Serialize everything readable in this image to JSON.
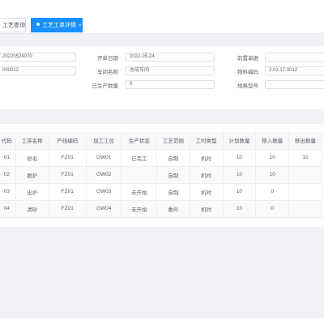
{
  "tabs": [
    {
      "label": "工艺查询",
      "active": false
    },
    {
      "label": "工艺工单详情",
      "active": true
    }
  ],
  "tab_close_glyph": "×",
  "accent_color": "#1890ff",
  "form": {
    "order_no_value": "20220524070",
    "second_value": "000012",
    "start_date_label": "开单日期",
    "start_date_value": "2022-05-24",
    "workshop_label": "车间名称",
    "workshop_value": "总成车间",
    "produced_qty_label": "已生产数量",
    "produced_qty_value": "0",
    "source_doc_label": "前置单据",
    "source_doc_value": "",
    "material_code_label": "物料编码",
    "material_code_value": "2.01.17.0012",
    "spec_label": "规格型号",
    "spec_value": ""
  },
  "table": {
    "headers": [
      "代码",
      "工序名称",
      "产线编码",
      "加工工位",
      "生产状态",
      "工艺范围",
      "工时类型",
      "计划数量",
      "移入数量",
      "移出数量"
    ],
    "rows": [
      [
        "01",
        "修毛",
        "FZ01",
        "GW01",
        "已完工",
        "自制",
        "机时",
        "10",
        "10",
        "10"
      ],
      [
        "02",
        "脱炉",
        "FZ01",
        "GW02",
        "",
        "自制",
        "机时",
        "10",
        "10",
        ""
      ],
      [
        "03",
        "出炉",
        "FZ01",
        "GW03",
        "未开始",
        "自制",
        "机时",
        "10",
        "0",
        ""
      ],
      [
        "04",
        "清砂",
        "FZ01",
        "GW04",
        "未开始",
        "委外",
        "机时",
        "10",
        "0",
        ""
      ]
    ]
  }
}
